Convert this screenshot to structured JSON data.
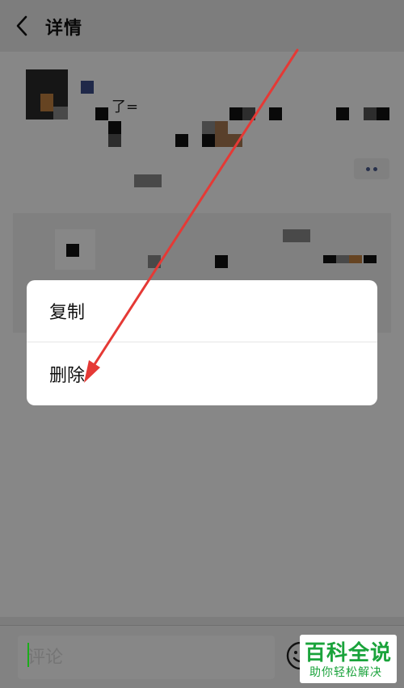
{
  "header": {
    "title": "详情",
    "back_icon": "chevron-left-icon"
  },
  "post": {
    "text_fragment": "了="
  },
  "context_menu": {
    "items": [
      {
        "label": "复制"
      },
      {
        "label": "删除"
      }
    ]
  },
  "comment_bar": {
    "placeholder": "评论",
    "emoji_icon": "smiley-icon"
  },
  "watermark": {
    "title": "百科全说",
    "subtitle": "助你轻松解决"
  },
  "colors": {
    "overlay": "#000000",
    "arrow": "#e53935",
    "watermark_green": "#1aa33b",
    "cursor_green": "#1aad19"
  }
}
